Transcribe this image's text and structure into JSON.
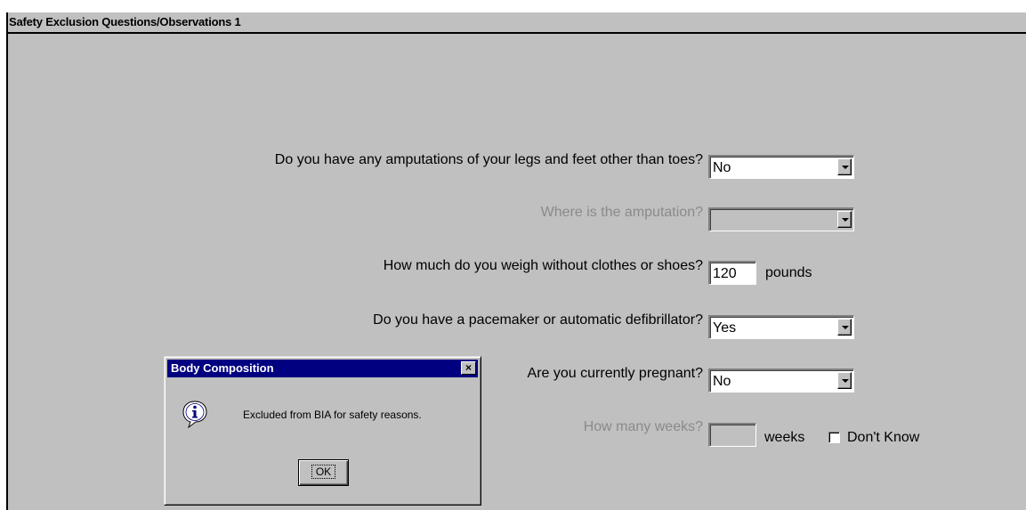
{
  "section": {
    "title": "Safety Exclusion Questions/Observations 1"
  },
  "questions": {
    "amputation": {
      "label": "Do you have any amputations of your legs and feet other than toes?",
      "value": "No"
    },
    "amputation_location": {
      "label": "Where is the amputation?",
      "value": ""
    },
    "weight": {
      "label": "How much do you weigh without clothes or shoes?",
      "value": "120",
      "unit": "pounds"
    },
    "pacemaker": {
      "label": "Do you have a pacemaker or automatic defibrillator?",
      "value": "Yes"
    },
    "pregnant": {
      "label": "Are you currently pregnant?",
      "value": "No"
    },
    "weeks": {
      "label": "How many weeks?",
      "value": "",
      "unit": "weeks",
      "dont_know_label": "Don't Know",
      "dont_know_checked": false
    }
  },
  "dialog": {
    "title": "Body Composition",
    "close_label": "×",
    "message": "Excluded from BIA for safety reasons.",
    "ok_label": "OK",
    "icon": "information-icon"
  },
  "colors": {
    "panel_bg": "#c0c0c0",
    "titlebar": "#000080",
    "disabled_text": "#8a8a8a"
  }
}
